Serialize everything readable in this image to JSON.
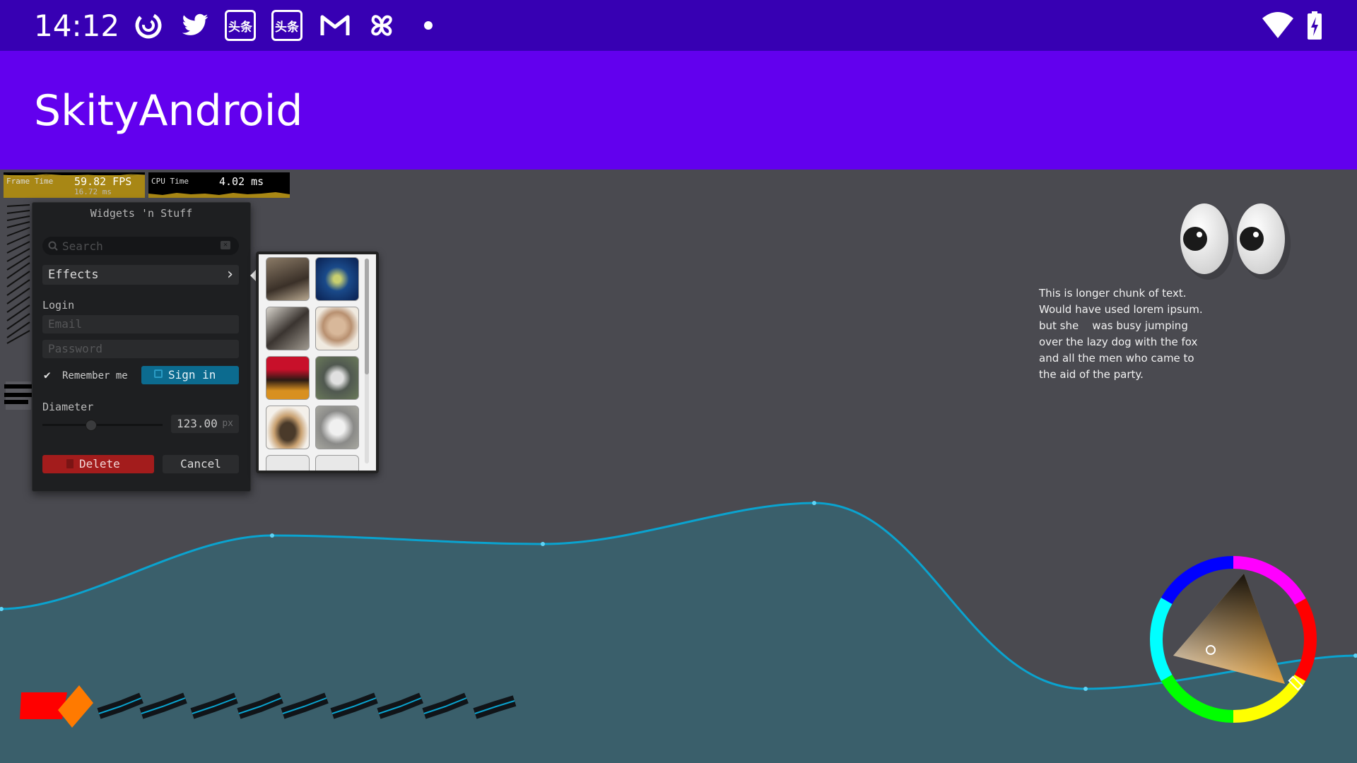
{
  "status_bar": {
    "time": "14:12",
    "notification_icons": [
      "pocketcasts-icon",
      "twitter-icon",
      "toutiao-icon",
      "toutiao-icon",
      "gmail-icon",
      "pinwheel-icon",
      "dot-icon"
    ],
    "toutiao_label": "头条",
    "system_icons": [
      "wifi-icon",
      "battery-charging-icon"
    ]
  },
  "app_bar": {
    "title": "SkityAndroid"
  },
  "perf": {
    "frame": {
      "label": "Frame Time",
      "fps": "59.82 FPS",
      "ms": "16.72 ms"
    },
    "cpu": {
      "label": "CPU Time",
      "ms": "4.02 ms"
    }
  },
  "widgets": {
    "title": "Widgets 'n Stuff",
    "search_placeholder": "Search",
    "effects_label": "Effects",
    "login_label": "Login",
    "email_placeholder": "Email",
    "password_placeholder": "Password",
    "remember_label": "Remember me",
    "signin_label": "Sign in",
    "diameter_label": "Diameter",
    "diameter_value": "123.00",
    "diameter_unit": "px",
    "slider_fraction": 0.4,
    "delete_label": "Delete",
    "cancel_label": "Cancel"
  },
  "paragraph": {
    "lines": [
      "This is longer chunk of text.",
      "Would have used lorem ipsum.",
      "but she    was busy jumping",
      "over the lazy dog with the fox",
      "and all the men who came to",
      "the aid of the party."
    ]
  },
  "colors": {
    "status_bar": "#3700b3",
    "app_bar": "#6200ee",
    "canvas": "#4a4a50",
    "graph_fill": "#3a5f6b",
    "graph_line": "#0aa3cf",
    "perf_gold": "#a88715",
    "delete_red": "#a31c1c",
    "signin_blue": "#0c6b8f"
  }
}
